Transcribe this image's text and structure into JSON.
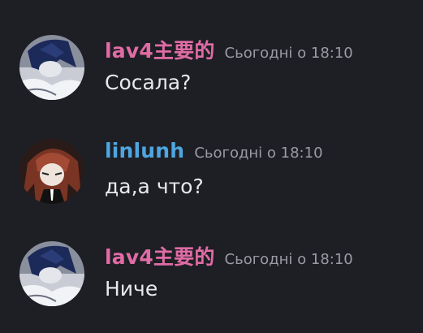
{
  "colors": {
    "background": "#1e1f24",
    "lav4_name": "#e06ca6",
    "linlunh_name": "#4ea6e0",
    "timestamp": "#9a9ba3",
    "message_text": "#e8e9ed"
  },
  "messages": [
    {
      "username": "lav4主要的",
      "timestamp": "Сьогодні о 18:10",
      "text": "Сосала?",
      "avatar_icon": "dark-haired-anime-character-avatar"
    },
    {
      "username": "linlunh",
      "timestamp": "Сьогодні о 18:10",
      "text": "да,а что?",
      "avatar_icon": "red-haired-anime-character-avatar"
    },
    {
      "username": "lav4主要的",
      "timestamp": "Сьогодні о 18:10",
      "text": "Ниче",
      "avatar_icon": "dark-haired-anime-character-avatar"
    }
  ]
}
